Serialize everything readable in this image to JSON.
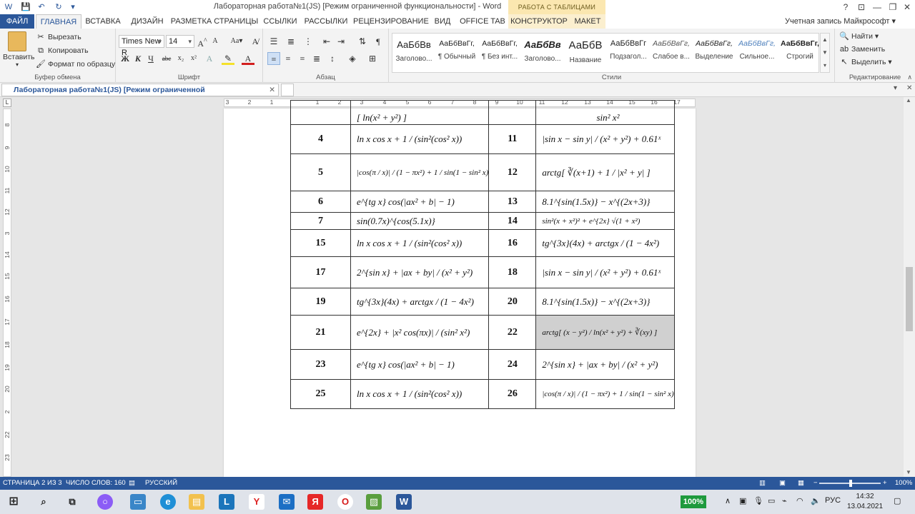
{
  "window": {
    "title": "Лабораторная работа№1(JS) [Режим ограниченной функциональности] - Word",
    "context_label": "РАБОТА С ТАБЛИЦАМИ",
    "help": "?",
    "minimize": "—",
    "maximize": "❐",
    "close": "✕"
  },
  "tabs": [
    "ФАЙЛ",
    "ГЛАВНАЯ",
    "ВСТАВКА",
    "ДИЗАЙН",
    "РАЗМЕТКА СТРАНИЦЫ",
    "ССЫЛКИ",
    "РАССЫЛКИ",
    "РЕЦЕНЗИРОВАНИЕ",
    "ВИД",
    "OFFICE TAB",
    "КОНСТРУКТОР",
    "МАКЕТ"
  ],
  "account": "Учетная запись Майкрософт ▾",
  "clipboard": {
    "paste": "Вставить",
    "cut": "Вырезать",
    "copy": "Копировать",
    "format_painter": "Формат по образцу",
    "label": "Буфер обмена"
  },
  "font": {
    "name": "Times New R",
    "size": "14",
    "label": "Шрифт",
    "bold": "Ж",
    "italic": "К",
    "underline": "Ч",
    "strike": "abc",
    "subscript": "x₂",
    "superscript": "x²"
  },
  "paragraph": {
    "label": "Абзац"
  },
  "styles": {
    "label": "Стили",
    "items": [
      {
        "sample": "АаБбВв",
        "name": "Заголово..."
      },
      {
        "sample": "АаБбВвГг,",
        "name": "¶ Обычный"
      },
      {
        "sample": "АаБбВвГг,",
        "name": "¶ Без инт..."
      },
      {
        "sample": "АаБбВв",
        "name": "Заголово..."
      },
      {
        "sample": "АаБбВ",
        "name": "Название"
      },
      {
        "sample": "АаБбВвГг",
        "name": "Подзагол..."
      },
      {
        "sample": "АаБбВвГг,",
        "name": "Слабое в..."
      },
      {
        "sample": "АаБбВвГг,",
        "name": "Выделение"
      },
      {
        "sample": "АаБбВвГг,",
        "name": "Сильное..."
      },
      {
        "sample": "АаБбВвГг,",
        "name": "Строгий"
      }
    ]
  },
  "editing": {
    "find": "Найти",
    "replace": "Заменить",
    "select": "Выделить",
    "label": "Редактирование"
  },
  "doc_tab": "Лабораторная работа№1(JS) [Режим ограниченной функциональности]",
  "doc_tab_close": "✕",
  "ruler_numbers": [
    "3",
    "2",
    "1",
    "1",
    "2",
    "3",
    "4",
    "5",
    "6",
    "7",
    "8",
    "9",
    "10",
    "11",
    "12",
    "13",
    "14",
    "15",
    "16",
    "17"
  ],
  "vruler_numbers": [
    "8",
    "9",
    "10",
    "11",
    "12",
    "3",
    "14",
    "15",
    "16",
    "17",
    "18",
    "19",
    "20",
    "2",
    "22",
    "23"
  ],
  "table": {
    "top_partial": {
      "n1": "",
      "f1": "[ ln(x² + y²) ]",
      "n2": "",
      "f2": "sin² x²"
    },
    "rows": [
      {
        "n1": "4",
        "f1": "ln x cos x + 1 / (sin²(cos² x))",
        "n2": "11",
        "f2": "|sin x − sin y| / (x² + y²) + 0.61ˣ"
      },
      {
        "n1": "5",
        "f1": "|cos(π / x)| / (1 − πx²) + 1 / sin(1 − sin² x)",
        "n2": "12",
        "f2": "arctg[ ∛(x+1) + 1 / |x² + y| ]"
      },
      {
        "n1": "6",
        "f1": "e^{tg x} cos(|ax² + b| − 1)",
        "n2": "13",
        "f2": "8.1^{sin(1.5x)} − x^{(2x+3)}"
      },
      {
        "n1": "7",
        "f1": "sin(0.7x)^{cos(5.1x)}",
        "n2": "14",
        "f2": "sin²(x + x²)² + e^{2x} √(1 + x²)"
      },
      {
        "n1": "15",
        "f1": "ln x cos x + 1 / (sin²(cos² x))",
        "n2": "16",
        "f2": "tg^{3x}(4x) + arctgx / (1 − 4x²)"
      },
      {
        "n1": "17",
        "f1": "2^{sin x} + |ax + by| / (x² + y²)",
        "n2": "18",
        "f2": "|sin x − sin y| / (x² + y²) + 0.61ˣ"
      },
      {
        "n1": "19",
        "f1": "tg^{3x}(4x) + arctgx / (1 − 4x²)",
        "n2": "20",
        "f2": "8.1^{sin(1.5x)} − x^{(2x+3)}"
      },
      {
        "n1": "21",
        "f1": "e^{2x} + |x² cos(πx)| / (sin² x²)",
        "n2": "22",
        "f2": "arctg[ (x − y²) / ln(x² + y²) + ∛(xy) ]"
      },
      {
        "n1": "23",
        "f1": "e^{tg x} cos(|ax² + b| − 1)",
        "n2": "24",
        "f2": "2^{sin x} + |ax + by| / (x² + y²)"
      },
      {
        "n1": "25",
        "f1": "ln x cos x + 1 / (sin²(cos² x))",
        "n2": "26",
        "f2": "|cos(π / x)| / (1 − πx²) + 1 / sin(1 − sin² x)"
      }
    ]
  },
  "status": {
    "page": "СТРАНИЦА 2 ИЗ 3",
    "words": "ЧИСЛО СЛОВ: 160",
    "lang": "РУССКИЙ",
    "zoom": "100%"
  },
  "taskbar": {
    "battery": "100%",
    "lang": "РУС",
    "time": "14:32",
    "date": "13.04.2021"
  }
}
